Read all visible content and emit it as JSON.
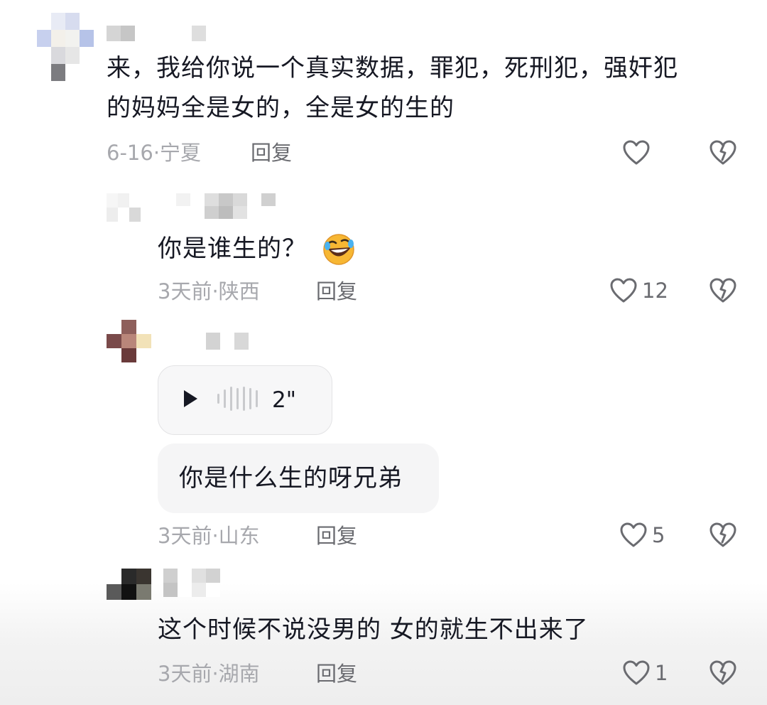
{
  "comments": [
    {
      "text_line1": "来，我给你说一个真实数据，罪犯，死刑犯，强奸犯",
      "text_line2": "的妈妈全是女的，全是女的生的",
      "date": "6-16",
      "location": "宁夏",
      "separator": "·",
      "reply_label": "回复",
      "likes": ""
    },
    {
      "text": "你是谁生的？",
      "emoji": "rolling-on-floor-laughing",
      "date": "3天前",
      "location": "陕西",
      "separator": "·",
      "reply_label": "回复",
      "likes": "12"
    },
    {
      "voice_duration": "2\"",
      "text": "你是什么生的呀兄弟",
      "date": "3天前",
      "location": "山东",
      "separator": "·",
      "reply_label": "回复",
      "likes": "5"
    },
    {
      "text": "这个时候不说没男的 女的就生不出来了",
      "date": "3天前",
      "location": "湖南",
      "separator": "·",
      "reply_label": "回复",
      "likes": "1"
    }
  ],
  "icons": {
    "like": "heart-outline-icon",
    "dislike": "broken-heart-icon",
    "play": "play-icon",
    "waveform": "waveform-icon"
  },
  "colors": {
    "text": "#161823",
    "meta": "#a7a8ad",
    "action": "#6a6b70",
    "bubble": "#f5f5f6"
  }
}
